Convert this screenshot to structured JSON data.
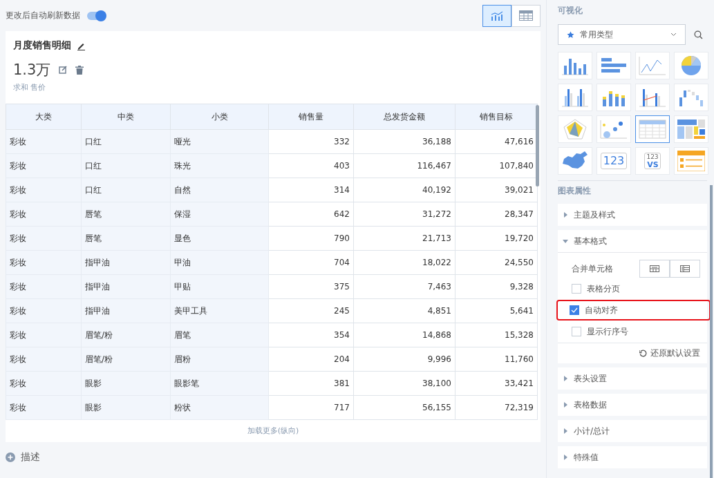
{
  "toolbar": {
    "auto_refresh_label": "更改后自动刷新数据",
    "auto_refresh_on": true,
    "view_toggle": [
      {
        "kind": "chart",
        "selected": true
      },
      {
        "kind": "table",
        "selected": false
      }
    ]
  },
  "card": {
    "title": "月度销售明细",
    "metric_value": "1.3万",
    "metric_caption": "求和 售价"
  },
  "table": {
    "columns": [
      "大类",
      "中类",
      "小类",
      "销售量",
      "总发货金额",
      "销售目标"
    ],
    "rows": [
      [
        "彩妆",
        "口红",
        "哑光",
        "332",
        "36,188",
        "47,616"
      ],
      [
        "彩妆",
        "口红",
        "珠光",
        "403",
        "116,467",
        "107,840"
      ],
      [
        "彩妆",
        "口红",
        "自然",
        "314",
        "40,192",
        "39,021"
      ],
      [
        "彩妆",
        "唇笔",
        "保湿",
        "642",
        "31,272",
        "28,347"
      ],
      [
        "彩妆",
        "唇笔",
        "显色",
        "790",
        "21,713",
        "19,720"
      ],
      [
        "彩妆",
        "指甲油",
        "甲油",
        "704",
        "18,022",
        "24,550"
      ],
      [
        "彩妆",
        "指甲油",
        "甲贴",
        "375",
        "7,463",
        "9,328"
      ],
      [
        "彩妆",
        "指甲油",
        "美甲工具",
        "245",
        "4,851",
        "5,641"
      ],
      [
        "彩妆",
        "眉笔/粉",
        "眉笔",
        "354",
        "14,868",
        "15,328"
      ],
      [
        "彩妆",
        "眉笔/粉",
        "眉粉",
        "204",
        "9,996",
        "11,760"
      ],
      [
        "彩妆",
        "眼影",
        "眼影笔",
        "381",
        "38,100",
        "33,421"
      ],
      [
        "彩妆",
        "眼影",
        "粉状",
        "717",
        "56,155",
        "72,319"
      ]
    ],
    "load_more": "加载更多(纵向)"
  },
  "describe_label": "描述",
  "panel": {
    "title": "可视化",
    "type_select": "常用类型",
    "chart_types": [
      {
        "kind": "column",
        "selected": false
      },
      {
        "kind": "bar",
        "selected": false
      },
      {
        "kind": "line",
        "selected": false
      },
      {
        "kind": "pie",
        "selected": false
      },
      {
        "kind": "grouped",
        "selected": false
      },
      {
        "kind": "stacked",
        "selected": false
      },
      {
        "kind": "combo",
        "selected": false
      },
      {
        "kind": "waterfall",
        "selected": false
      },
      {
        "kind": "radar",
        "selected": false
      },
      {
        "kind": "scatter",
        "selected": false
      },
      {
        "kind": "table",
        "selected": true
      },
      {
        "kind": "treemap",
        "selected": false
      },
      {
        "kind": "map",
        "selected": false
      },
      {
        "kind": "number",
        "selected": false
      },
      {
        "kind": "compare",
        "selected": false
      },
      {
        "kind": "list",
        "selected": false
      }
    ],
    "number_tile_text": "123",
    "compare_tile_text": "123",
    "compare_tile_vs": "VS",
    "props_title": "图表属性",
    "sections": [
      {
        "label": "主题及样式",
        "expanded": false
      },
      {
        "label": "基本格式",
        "expanded": true,
        "merge_label": "合并单元格",
        "options": [
          {
            "label": "表格分页",
            "checked": false,
            "highlighted": false
          },
          {
            "label": "自动对齐",
            "checked": true,
            "highlighted": true
          },
          {
            "label": "显示行序号",
            "checked": false,
            "highlighted": false
          }
        ],
        "reset_label": "还原默认设置"
      },
      {
        "label": "表头设置",
        "expanded": false
      },
      {
        "label": "表格数据",
        "expanded": false
      },
      {
        "label": "小计/总计",
        "expanded": false
      },
      {
        "label": "特殊值",
        "expanded": false
      }
    ]
  }
}
